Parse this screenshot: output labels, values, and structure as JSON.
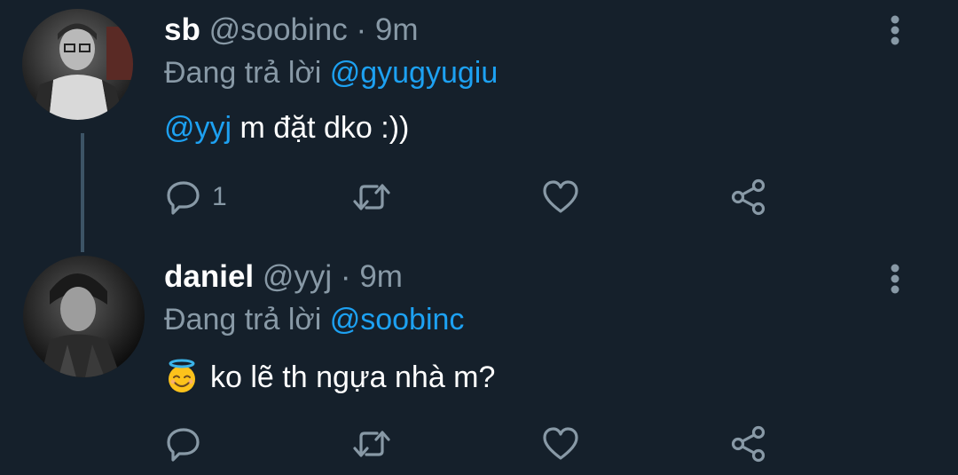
{
  "tweets": [
    {
      "name": "sb",
      "handle": "@soobinc",
      "separator": "·",
      "time": "9m",
      "reply_prefix": "Đang trả lời",
      "reply_mention": "@gyugyugiu",
      "body_mention": "@yyj",
      "body_text": " m đặt dko :))",
      "reply_count": "1",
      "avatar_icon": "avatar-photo"
    },
    {
      "name": "daniel",
      "handle": "@yyj",
      "separator": "·",
      "time": "9m",
      "reply_prefix": "Đang trả lời",
      "reply_mention": "@soobinc",
      "body_emoji": "smiling-face-with-halo-emoji",
      "body_text": "ko lẽ th ngựa nhà m?",
      "reply_count": "",
      "avatar_icon": "avatar-photo"
    }
  ],
  "colors": {
    "background": "#15202b",
    "text_primary": "#ffffff",
    "text_secondary": "#8899a6",
    "accent": "#1da1f2",
    "thread_line": "#3d5466"
  },
  "icons": [
    "reply-icon",
    "retweet-icon",
    "like-icon",
    "share-icon",
    "more-options-icon"
  ]
}
